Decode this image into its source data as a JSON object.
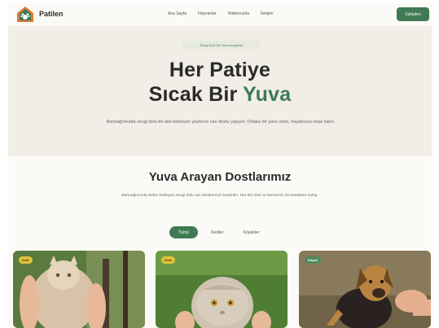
{
  "nav": {
    "brand": "Patilen",
    "links": [
      "Ana Sayfa",
      "Hayvanlar",
      "Hakkımızda",
      "İletişim"
    ],
    "cta": "Sahiplen"
  },
  "hero": {
    "badge": "Sevgi Dolu Bir Yuva Arayanlar",
    "title_line1": "Her Patiye",
    "title_line2_prefix": "Sıcak Bir ",
    "title_line2_accent": "Yuva",
    "description": "Barınağımızda sevgi dolu bir aile bekleyen yüzlerce can dostu yaşıyor. Onlara bir şans verin, hayatınıza neşe katın."
  },
  "section": {
    "title": "Yuva Arayan Dostlarımız",
    "description": "Barınağımızda sizleri bekleyen sevgi dolu can dostlarımızı keşfedin. Her biri özel ve benzersiz bir karaktere sahip."
  },
  "filters": {
    "items": [
      "Tümü",
      "Kediler",
      "Köpekler"
    ],
    "active": "Tümü"
  },
  "cards": [
    {
      "tag": "Kedi",
      "tag_color": "#e0c23a"
    },
    {
      "tag": "Kedi",
      "tag_color": "#e0c23a"
    },
    {
      "tag": "Köpek",
      "tag_color": "#4f8a5e"
    }
  ],
  "colors": {
    "primary": "#3f7a53",
    "hero_bg": "#f1ede7",
    "accent_yellow": "#e0c23a"
  }
}
